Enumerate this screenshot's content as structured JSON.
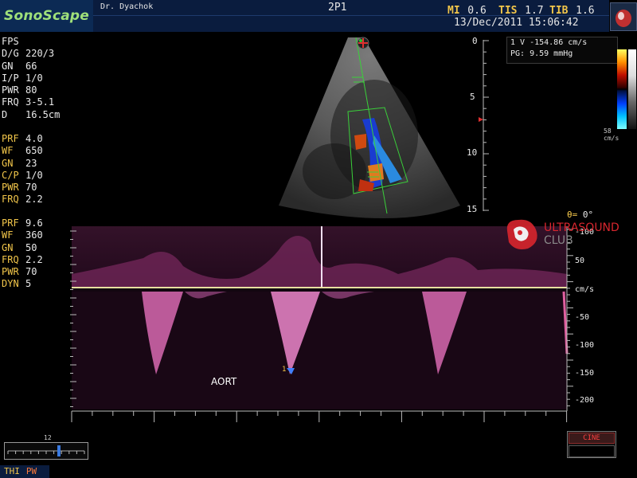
{
  "header": {
    "brand": "SonoScape",
    "operator": "Dr. Dyachok",
    "probe": "2P1",
    "mi_label": "MI",
    "mi_value": "0.6",
    "tis_label": "TIS",
    "tis_value": "1.7",
    "tib_label": "TIB",
    "tib_value": "1.6",
    "datetime": "13/Dec/2011 15:06:42"
  },
  "params_2d": [
    {
      "name": "FPS",
      "value": ""
    },
    {
      "name": "D/G",
      "value": "220/3"
    },
    {
      "name": "GN",
      "value": "66"
    },
    {
      "name": "I/P",
      "value": "1/0"
    },
    {
      "name": "PWR",
      "value": "80"
    },
    {
      "name": "FRQ",
      "value": "3-5.1"
    },
    {
      "name": "D",
      "value": "16.5cm"
    }
  ],
  "params_color": [
    {
      "name": "PRF",
      "value": "4.0"
    },
    {
      "name": "WF",
      "value": "650"
    },
    {
      "name": "GN",
      "value": "23"
    },
    {
      "name": "C/P",
      "value": "1/0"
    },
    {
      "name": "PWR",
      "value": "70"
    },
    {
      "name": "FRQ",
      "value": "2.2"
    }
  ],
  "params_pw": [
    {
      "name": "PRF",
      "value": "9.6"
    },
    {
      "name": "WF",
      "value": "360"
    },
    {
      "name": "GN",
      "value": "50"
    },
    {
      "name": "FRQ",
      "value": "2.2"
    },
    {
      "name": "PWR",
      "value": "70"
    },
    {
      "name": "DYN",
      "value": "5"
    }
  ],
  "measurement": {
    "line1": "1 V  -154.86 cm/s",
    "line2": "PG:  9.59 mmHg"
  },
  "color_scale": {
    "top": "58",
    "unit": "cm/s"
  },
  "depth_scale": [
    "0",
    "5",
    "10",
    "15"
  ],
  "angle": {
    "label": "θ=",
    "value": "0°"
  },
  "velocity_scale": {
    "labels": [
      "-100",
      "50",
      "cm/s",
      "-50",
      "-100",
      "-150",
      "-200"
    ],
    "unit": "cm/s"
  },
  "watermark": {
    "line1": "ULTRASOUND",
    "line2": "CLUB"
  },
  "cursor_marker": "1",
  "annotation": "AORT",
  "footer": {
    "slider_value": "12",
    "mode1": "THI",
    "mode2": "PW",
    "cine": "CINE"
  },
  "colors": {
    "param_yellow": "#f2c64a",
    "brand_green": "#9fe07a",
    "header_bg": "#0a1c3e",
    "doppler_pink": "#e070b8"
  }
}
